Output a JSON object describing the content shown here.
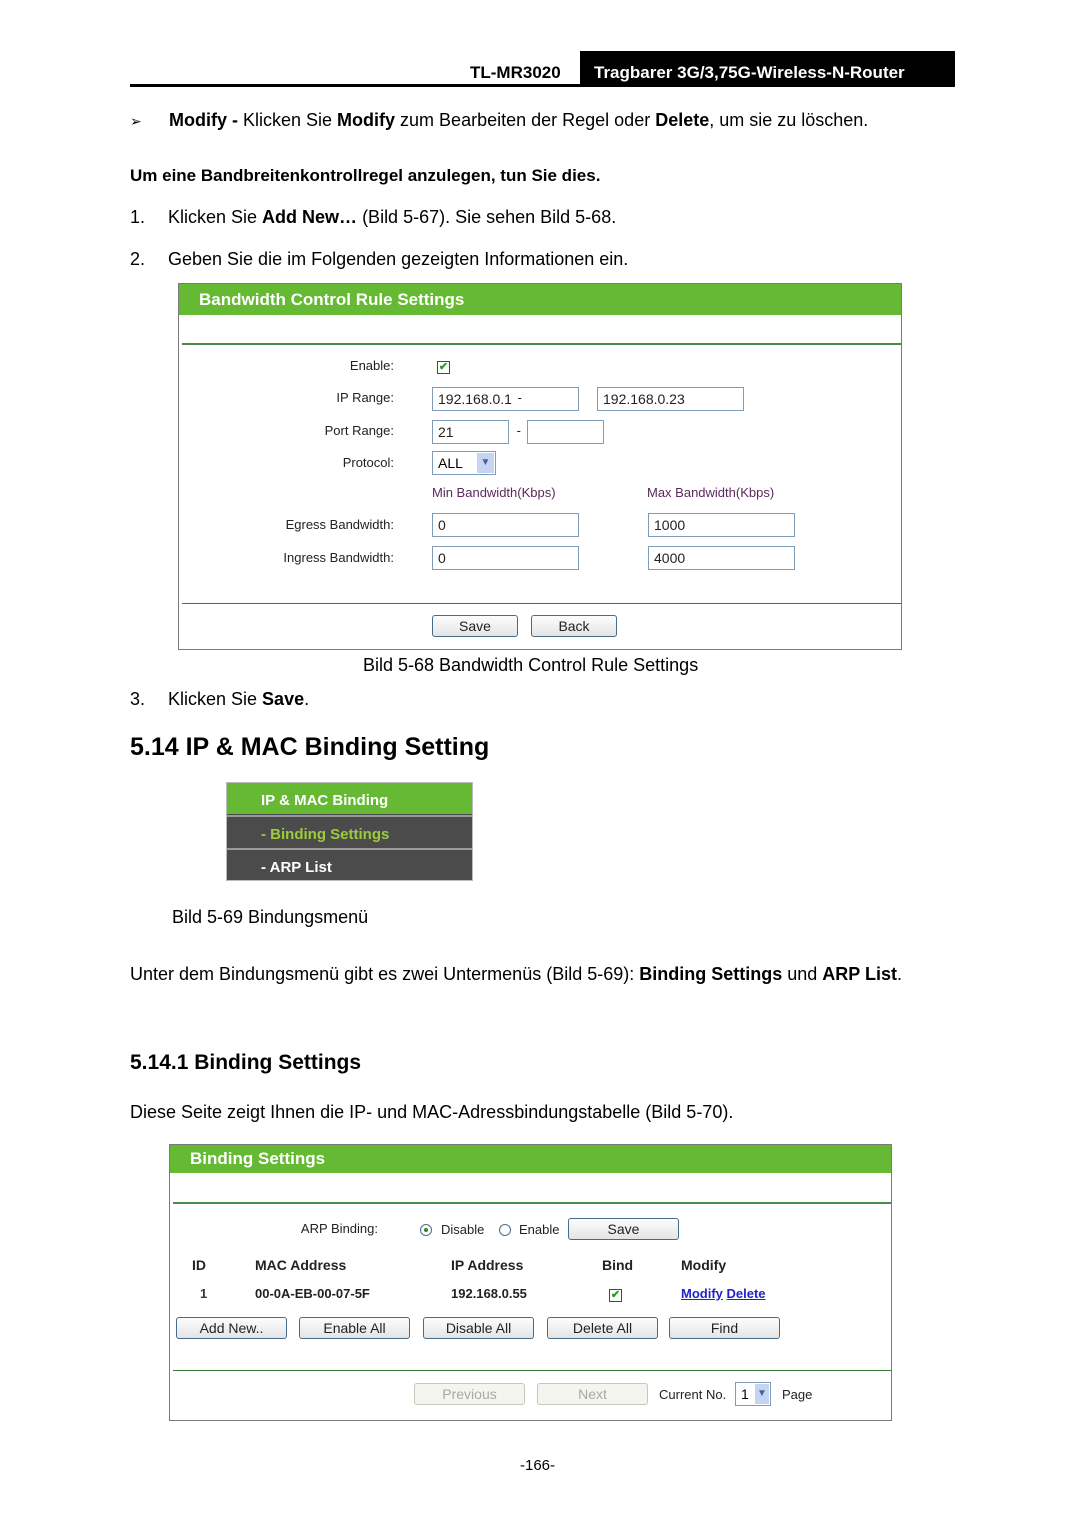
{
  "header": {
    "model": "TL-MR3020",
    "product": "Tragbarer 3G/3,75G-Wireless-N-Router"
  },
  "intro": {
    "bullet_glyph": "➢",
    "modify_line": {
      "b1": "Modify - ",
      "t1": "Klicken Sie ",
      "b2": "Modify",
      "t2": " zum Bearbeiten der Regel oder ",
      "b3": "Delete",
      "t3": ", um sie zu löschen."
    },
    "subheading": "Um eine Bandbreitenkontrollregel anzulegen, tun Sie dies.",
    "step1": {
      "num": "1.",
      "t1": "Klicken Sie ",
      "b1": "Add New…",
      "t2": " (Bild 5-67). Sie sehen Bild 5-68."
    },
    "step2": {
      "num": "2.",
      "text": "Geben Sie die im Folgenden gezeigten Informationen ein."
    }
  },
  "bandwidth_panel": {
    "title": "Bandwidth Control Rule Settings",
    "enable_label": "Enable:",
    "enable_checked": true,
    "ip_range_label": "IP Range:",
    "ip_start": "192.168.0.1",
    "ip_end": "192.168.0.23",
    "port_range_label": "Port Range:",
    "port_start": "21",
    "port_end": "",
    "range_sep": "-",
    "protocol_label": "Protocol:",
    "protocol_value": "ALL",
    "min_header": "Min Bandwidth(Kbps)",
    "max_header": "Max Bandwidth(Kbps)",
    "egress_label": "Egress Bandwidth:",
    "egress_min": "0",
    "egress_max": "1000",
    "ingress_label": "Ingress Bandwidth:",
    "ingress_min": "0",
    "ingress_max": "4000",
    "save_label": "Save",
    "back_label": "Back"
  },
  "caption_568": "Bild 5-68 Bandwidth Control Rule Settings",
  "step3": {
    "num": "3.",
    "t1": "Klicken Sie ",
    "b1": "Save",
    "t2": "."
  },
  "section_title": "5.14  IP & MAC Binding Setting",
  "menu": {
    "title": "IP & MAC Binding",
    "items": [
      {
        "label": "- Binding Settings",
        "active": true
      },
      {
        "label": "- ARP List",
        "active": false
      }
    ],
    "active_color": "#9ccc3c",
    "title_color": "#66b933"
  },
  "caption_569": "Bild 5-69 Bindungsmenü",
  "menu_para": {
    "t1": "Unter dem Bindungsmenü gibt es zwei Untermenüs (Bild 5-69): ",
    "b1": "Binding Settings",
    "t2": " und ",
    "b2": "ARP List",
    "t3": "."
  },
  "subsection_title": "5.14.1  Binding Settings",
  "subsection_para": "Diese Seite zeigt Ihnen die IP- und MAC-Adressbindungstabelle (Bild 5-70).",
  "binding_panel": {
    "title": "Binding Settings",
    "arp_label": "ARP Binding:",
    "arp_options": [
      "Disable",
      "Enable"
    ],
    "arp_selected": "Disable",
    "save_label": "Save",
    "columns": [
      "ID",
      "MAC Address",
      "IP Address",
      "Bind",
      "Modify"
    ],
    "rows": [
      {
        "id": "1",
        "mac": "00-0A-EB-00-07-5F",
        "ip": "192.168.0.55",
        "bind": true,
        "modify": "Modify",
        "delete": "Delete"
      }
    ],
    "buttons": [
      "Add New..",
      "Enable All",
      "Disable All",
      "Delete All",
      "Find"
    ],
    "previous_label": "Previous",
    "next_label": "Next",
    "current_no_label": "Current No.",
    "current_page": "1",
    "page_label": "Page"
  },
  "page_number": "-166-"
}
